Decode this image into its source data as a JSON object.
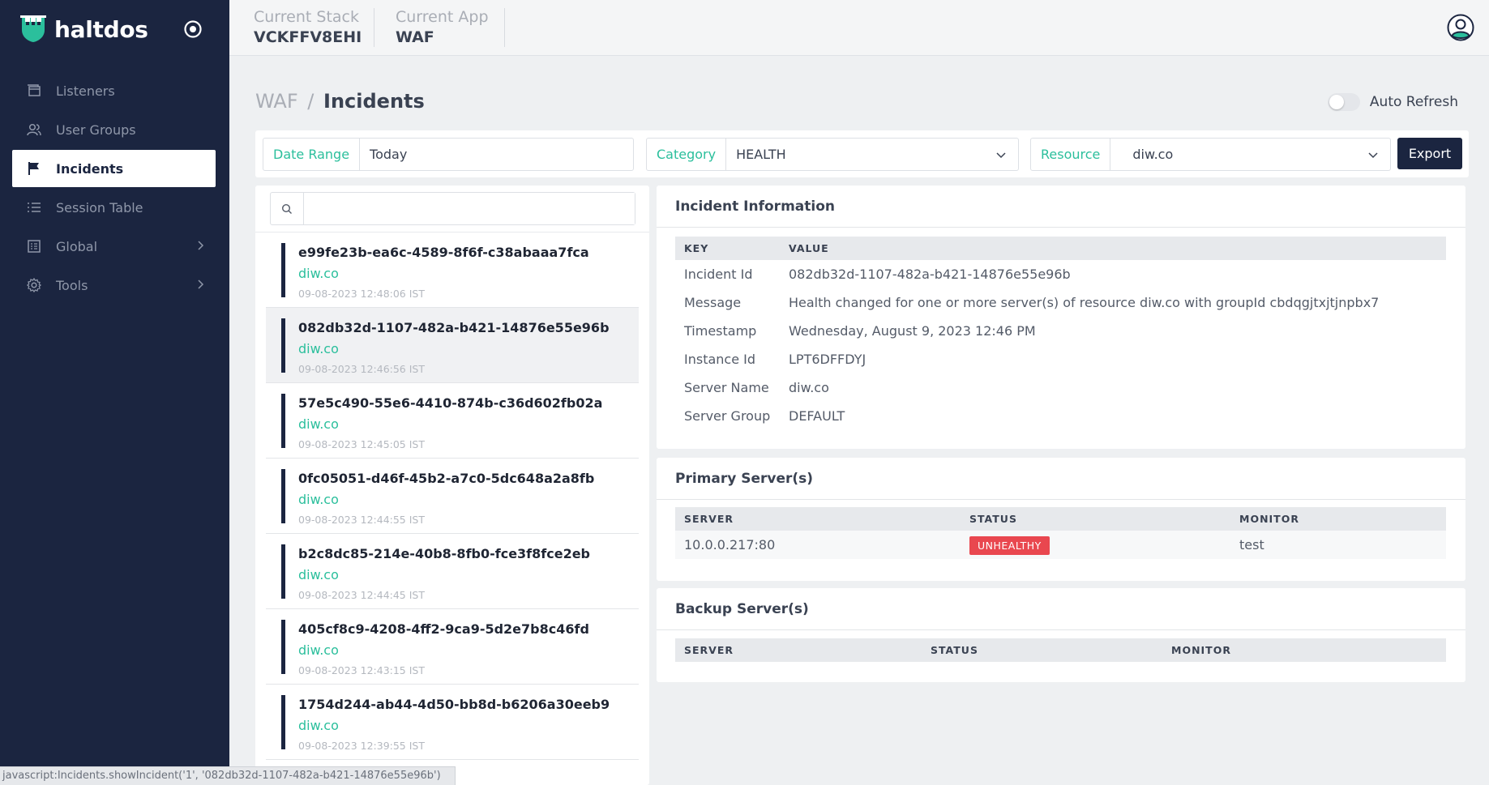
{
  "brand": {
    "name": "haltdos"
  },
  "sidebar": {
    "items": [
      {
        "label": "Listeners",
        "icon": "window-icon"
      },
      {
        "label": "User Groups",
        "icon": "users-icon"
      },
      {
        "label": "Incidents",
        "icon": "flag-icon",
        "active": true
      },
      {
        "label": "Session Table",
        "icon": "list-icon"
      },
      {
        "label": "Global",
        "icon": "grid-icon",
        "has_children": true
      },
      {
        "label": "Tools",
        "icon": "gear-icon",
        "has_children": true
      }
    ]
  },
  "topbar": {
    "stack_label": "Current Stack",
    "stack_value": "VCKFFV8EHI",
    "app_label": "Current App",
    "app_value": "WAF"
  },
  "breadcrumb": {
    "parent": "WAF",
    "separator": "/",
    "current": "Incidents"
  },
  "auto_refresh": {
    "label": "Auto Refresh",
    "enabled": false
  },
  "filters": {
    "date_range": {
      "label": "Date Range",
      "value": "Today"
    },
    "category": {
      "label": "Category",
      "value": "HEALTH"
    },
    "resource": {
      "label": "Resource",
      "value": "diw.co"
    },
    "export_label": "Export"
  },
  "search": {
    "placeholder": ""
  },
  "incidents": [
    {
      "id": "e99fe23b-ea6c-4589-8f6f-c38abaaa7fca",
      "resource": "diw.co",
      "timestamp": "09-08-2023 12:48:06 IST"
    },
    {
      "id": "082db32d-1107-482a-b421-14876e55e96b",
      "resource": "diw.co",
      "timestamp": "09-08-2023 12:46:56 IST",
      "selected": true
    },
    {
      "id": "57e5c490-55e6-4410-874b-c36d602fb02a",
      "resource": "diw.co",
      "timestamp": "09-08-2023 12:45:05 IST"
    },
    {
      "id": "0fc05051-d46f-45b2-a7c0-5dc648a2a8fb",
      "resource": "diw.co",
      "timestamp": "09-08-2023 12:44:55 IST"
    },
    {
      "id": "b2c8dc85-214e-40b8-8fb0-fce3f8fce2eb",
      "resource": "diw.co",
      "timestamp": "09-08-2023 12:44:45 IST"
    },
    {
      "id": "405cf8c9-4208-4ff2-9ca9-5d2e7b8c46fd",
      "resource": "diw.co",
      "timestamp": "09-08-2023 12:43:15 IST"
    },
    {
      "id": "1754d244-ab44-4d50-bb8d-b6206a30eeb9",
      "resource": "diw.co",
      "timestamp": "09-08-2023 12:39:55 IST"
    }
  ],
  "incident_info": {
    "title": "Incident Information",
    "key_header": "KEY",
    "value_header": "VALUE",
    "rows": [
      {
        "key": "Incident Id",
        "value": "082db32d-1107-482a-b421-14876e55e96b"
      },
      {
        "key": "Message",
        "value": "Health changed for one or more server(s) of resource diw.co with groupId cbdqgjtxjtjnpbx7"
      },
      {
        "key": "Timestamp",
        "value": "Wednesday, August 9, 2023 12:46 PM"
      },
      {
        "key": "Instance Id",
        "value": "LPT6DFFDYJ"
      },
      {
        "key": "Server Name",
        "value": "diw.co"
      },
      {
        "key": "Server Group",
        "value": "DEFAULT"
      }
    ]
  },
  "primary_servers": {
    "title": "Primary Server(s)",
    "headers": {
      "server": "SERVER",
      "status": "STATUS",
      "monitor": "MONITOR"
    },
    "rows": [
      {
        "server": "10.0.0.217:80",
        "status": "UNHEALTHY",
        "monitor": "test"
      }
    ]
  },
  "backup_servers": {
    "title": "Backup Server(s)",
    "headers": {
      "server": "SERVER",
      "status": "STATUS",
      "monitor": "MONITOR"
    }
  },
  "statusbar": {
    "text": "javascript:Incidents.showIncident('1', '082db32d-1107-482a-b421-14876e55e96b')"
  },
  "colors": {
    "sidebar": "#1b2540",
    "accent": "#2bbf9c",
    "danger": "#e9474f"
  }
}
